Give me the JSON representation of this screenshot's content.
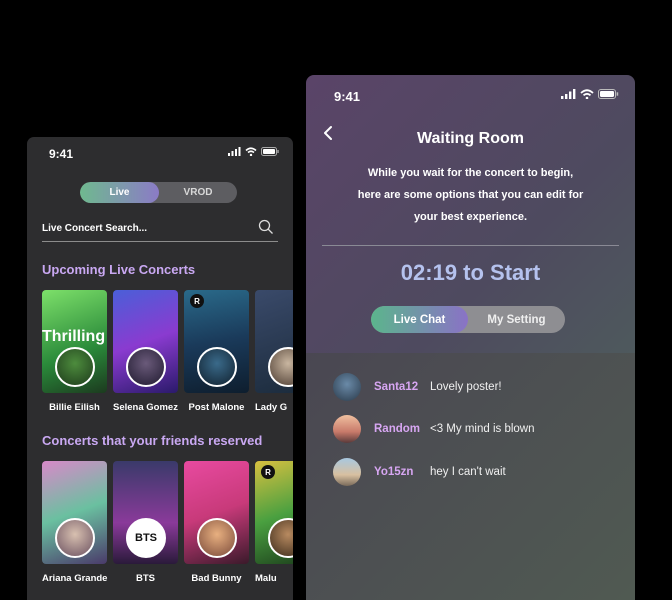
{
  "left_phone": {
    "time": "9:41",
    "toggle": {
      "active": "Live",
      "inactive": "VROD"
    },
    "search": {
      "label": "Live Concert Search..."
    },
    "upcoming": {
      "title": "Upcoming Live Concerts",
      "items": [
        {
          "name": "Billie Eilish",
          "poster_text": "Thrilling"
        },
        {
          "name": "Selena Gomez",
          "poster_text": ""
        },
        {
          "name": "Post Malone",
          "poster_text": "R"
        },
        {
          "name": "Lady G",
          "poster_text": ""
        }
      ]
    },
    "reserved": {
      "title": "Concerts that your friends reserved",
      "items": [
        {
          "name": "Ariana Grande",
          "poster_text": ""
        },
        {
          "name": "BTS",
          "poster_text": "BTS"
        },
        {
          "name": "Bad Bunny",
          "poster_text": ""
        },
        {
          "name": "Malu",
          "poster_text": "R"
        }
      ]
    }
  },
  "right_phone": {
    "time": "9:41",
    "title": "Waiting Room",
    "description_lines": [
      "While you wait for the concert to begin,",
      "here are some options that you can edit for",
      "your best experience."
    ],
    "countdown": "02:19 to Start",
    "tabs": {
      "active": "Live Chat",
      "inactive": "My Setting"
    },
    "messages": [
      {
        "user": "Santa12",
        "text": "Lovely poster!"
      },
      {
        "user": "Random",
        "text": "<3 My mind is blown"
      },
      {
        "user": "Yo15zn",
        "text": "hey I can't wait"
      }
    ]
  },
  "colors": {
    "accent_purple": "#c9a8f2",
    "accent_green": "#6fb98f",
    "countdown": "#b5c2ee"
  },
  "icons": [
    "signal-icon",
    "wifi-icon",
    "battery-icon",
    "search-icon",
    "back-chevron-icon"
  ]
}
